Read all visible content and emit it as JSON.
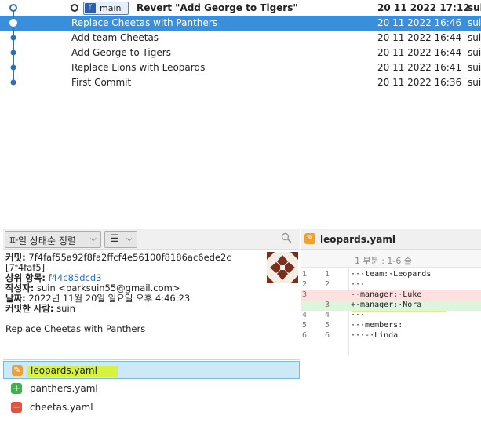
{
  "commits": [
    {
      "message": "Revert \"Add George to Tigers\"",
      "date": "20 11 2022 17:12",
      "author": "sui",
      "bold": true,
      "branch": "main"
    },
    {
      "message": "Replace Cheetas with Panthers",
      "date": "20 11 2022 16:46",
      "author": "sui",
      "selected": true
    },
    {
      "message": "Add team Cheetas",
      "date": "20 11 2022 16:44",
      "author": "sui"
    },
    {
      "message": "Add George to Tigers",
      "date": "20 11 2022 16:44",
      "author": "sui"
    },
    {
      "message": "Replace Lions with Leopards",
      "date": "20 11 2022 16:41",
      "author": "sui"
    },
    {
      "message": "First Commit",
      "date": "20 11 2022 16:36",
      "author": "sui"
    }
  ],
  "toolbar": {
    "sort_label": "파일 상태순 정렬"
  },
  "details": {
    "commit_label": "커밋:",
    "commit_hash": "7f4faf55a92f8fa2ffcf4e56100f8186ac6ede2c",
    "short_hash": "[7f4faf5]",
    "parent_label": "상위 항목:",
    "parent_hash": "f44c85dcd3",
    "author_label": "작성자:",
    "author_value": "suin <parksuin55@gmail.com>",
    "date_label": "날짜:",
    "date_value": "2022년 11월 20일 일요일 오후 4:46:23",
    "committer_label": "커밋한 사람:",
    "committer_value": "suin",
    "message": "Replace Cheetas with Panthers"
  },
  "files": [
    {
      "name": "leopards.yaml",
      "status": "modified",
      "icon": "pencil-icon",
      "selected": true
    },
    {
      "name": "panthers.yaml",
      "status": "added",
      "icon": "plus-icon"
    },
    {
      "name": "cheetas.yaml",
      "status": "removed",
      "icon": "minus-icon"
    }
  ],
  "diff": {
    "file_name": "leopards.yaml",
    "hunk_label": "1 부분 : 1-6 줄",
    "lines": [
      {
        "old": "1",
        "new": "1",
        "code": "···team:·Leopards",
        "type": "context"
      },
      {
        "old": "2",
        "new": "2",
        "code": "···",
        "type": "context"
      },
      {
        "old": "3",
        "new": "",
        "code": "-·manager:·Luke",
        "type": "removed"
      },
      {
        "old": "",
        "new": "3",
        "code": "+·manager:·Nora",
        "type": "added"
      },
      {
        "old": "4",
        "new": "4",
        "code": "···",
        "type": "context"
      },
      {
        "old": "5",
        "new": "5",
        "code": "···members:",
        "type": "context"
      },
      {
        "old": "6",
        "new": "6",
        "code": "···-·Linda",
        "type": "context"
      }
    ]
  },
  "colors": {
    "selected_row": "#3a8fdd",
    "graph_line": "#2e6fb5",
    "highlight": "#d9f500"
  }
}
